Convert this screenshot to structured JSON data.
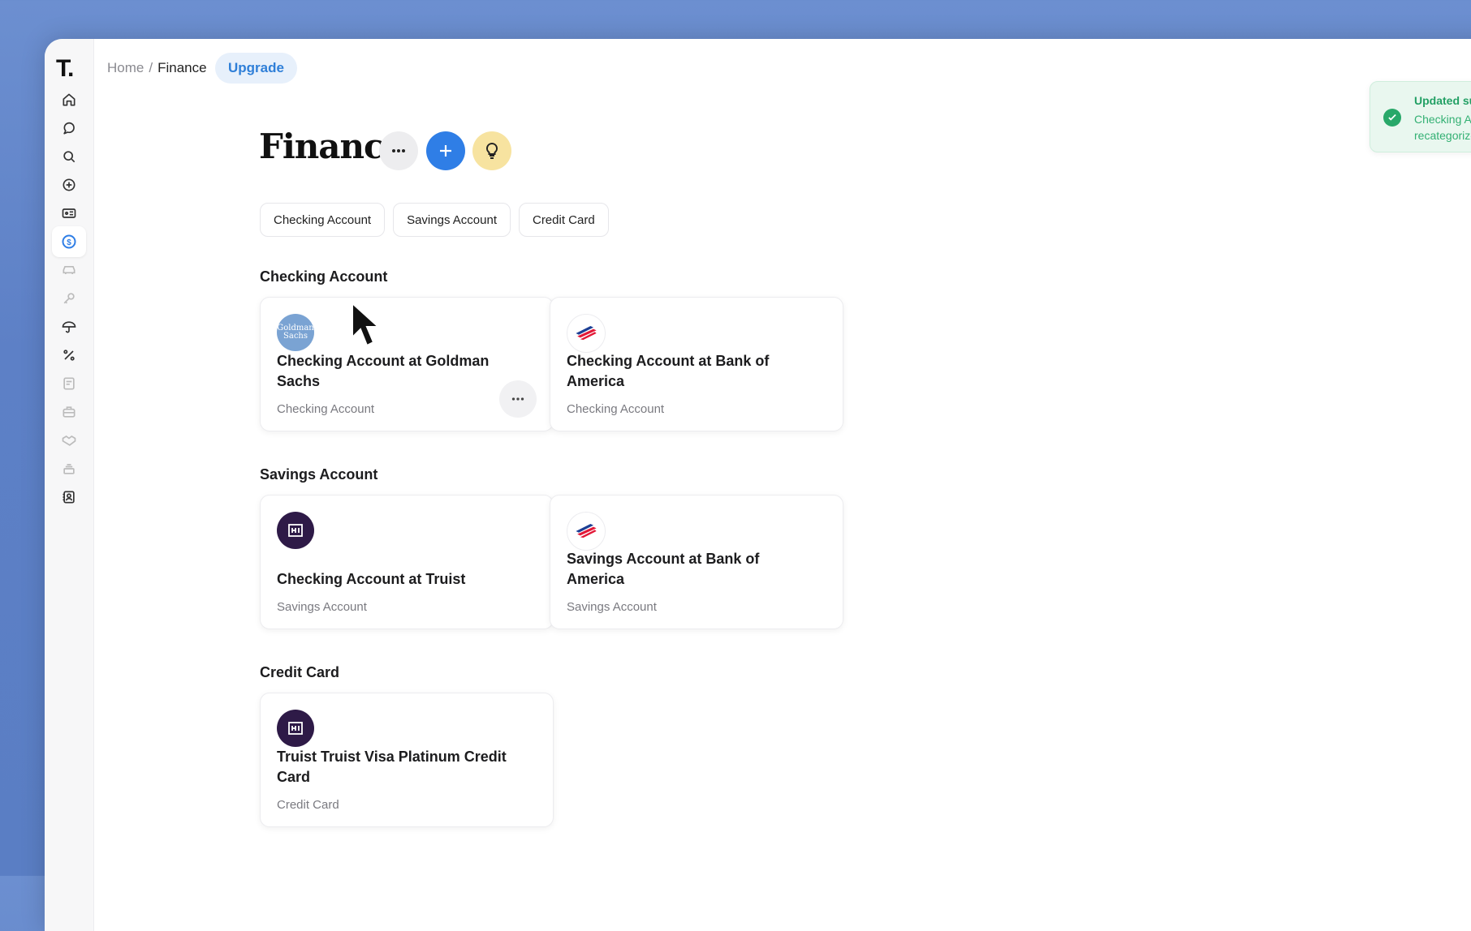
{
  "app": {
    "logo": "T."
  },
  "breadcrumb": {
    "home": "Home",
    "separator": "/",
    "current": "Finance"
  },
  "upgrade_label": "Upgrade",
  "page_title": "Finance",
  "filter_chips": [
    "Checking Account",
    "Savings Account",
    "Credit Card"
  ],
  "sections": [
    {
      "title": "Checking Account",
      "accounts": [
        {
          "name": "Checking Account at Goldman Sachs",
          "type": "Checking Account",
          "logo": "Goldman Sachs"
        },
        {
          "name": "Checking Account at Bank of America",
          "type": "Checking Account",
          "logo": "bank-of-america-logo"
        }
      ]
    },
    {
      "title": "Savings Account",
      "accounts": [
        {
          "name": "Checking Account at Truist",
          "type": "Savings Account",
          "logo": "truist-logo"
        },
        {
          "name": "Savings Account at Bank of America",
          "type": "Savings Account",
          "logo": "bank-of-america-logo"
        }
      ]
    },
    {
      "title": "Credit Card",
      "accounts": [
        {
          "name": "Truist Truist Visa Platinum Credit Card",
          "type": "Credit Card",
          "logo": "truist-logo"
        }
      ]
    }
  ],
  "sidebar_icons": [
    "home-icon",
    "chat-icon",
    "search-icon",
    "add-circle-icon",
    "id-card-icon",
    "finance-icon",
    "car-icon",
    "key-icon",
    "umbrella-icon",
    "percent-icon",
    "document-icon",
    "briefcase-icon",
    "handshake-icon",
    "layers-icon",
    "contacts-icon"
  ],
  "toast": {
    "title": "Updated subcateg",
    "body_line1": "Checking Account",
    "body_line2": "recategorized as a"
  },
  "colors": {
    "accent": "#2f7ee6",
    "toast_green": "#23a065",
    "truist": "#2e1a47"
  }
}
